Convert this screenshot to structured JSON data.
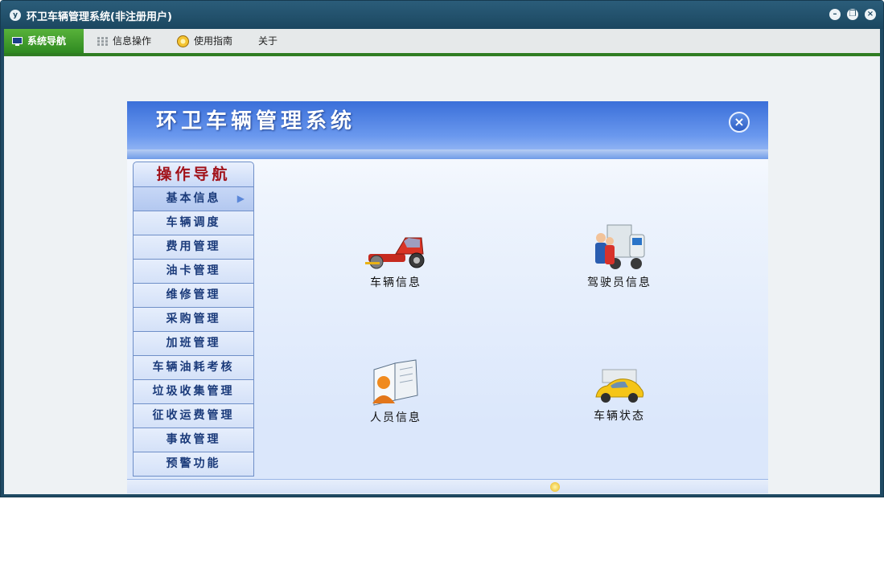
{
  "window": {
    "title": "环卫车辆管理系统(非注册用户)",
    "app_icon": "app-logo-icon",
    "controls": [
      "minimize-icon",
      "restore-icon",
      "close-icon"
    ]
  },
  "menu": [
    {
      "label": "系统导航",
      "icon": "monitor-icon",
      "active": true
    },
    {
      "label": "信息操作",
      "icon": "grid-icon",
      "active": false
    },
    {
      "label": "使用指南",
      "icon": "guide-icon",
      "active": false
    },
    {
      "label": "关于",
      "icon": "",
      "active": false
    }
  ],
  "panel": {
    "banner_title": "环卫车辆管理系统",
    "nav_header": "操作导航",
    "nav_items": [
      {
        "label": "基本信息",
        "active": true
      },
      {
        "label": "车辆调度",
        "active": false
      },
      {
        "label": "费用管理",
        "active": false
      },
      {
        "label": "油卡管理",
        "active": false
      },
      {
        "label": "维修管理",
        "active": false
      },
      {
        "label": "采购管理",
        "active": false
      },
      {
        "label": "加班管理",
        "active": false
      },
      {
        "label": "车辆油耗考核",
        "active": false
      },
      {
        "label": "垃圾收集管理",
        "active": false
      },
      {
        "label": "征收运费管理",
        "active": false
      },
      {
        "label": "事故管理",
        "active": false
      },
      {
        "label": "预警功能",
        "active": false
      }
    ],
    "tiles": [
      {
        "label": "车辆信息",
        "icon": "street-sweeper-icon"
      },
      {
        "label": "驾驶员信息",
        "icon": "drivers-truck-icon"
      },
      {
        "label": "人员信息",
        "icon": "personnel-book-icon"
      },
      {
        "label": "车辆状态",
        "icon": "yellow-car-icon"
      }
    ]
  },
  "colors": {
    "titlebar": "#1b4760",
    "menu_active": "#2f8a21",
    "banner": "#3a6fd9",
    "nav_header_text": "#a1121a",
    "nav_text": "#1a3a7a"
  }
}
